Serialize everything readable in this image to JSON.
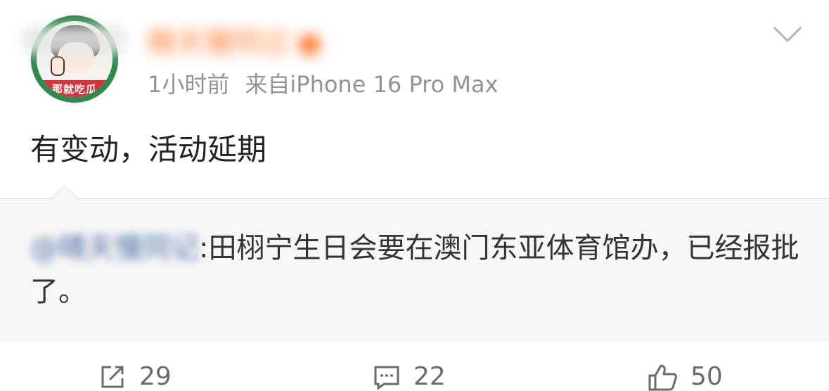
{
  "post": {
    "author_name": "睛天慢同记 ●",
    "avatar_banner": "那就吃瓜",
    "time": "1小时前",
    "source": "来自iPhone 16 Pro Max",
    "text": "有变动，活动延期"
  },
  "repost": {
    "original_author": "@晴天慢同记",
    "text": ":田栩宁生日会要在澳门东亚体育馆办，已经报批了。"
  },
  "actions": {
    "repost_count": "29",
    "comment_count": "22",
    "like_count": "50"
  },
  "colors": {
    "username": "#ff7a2f",
    "meta_text": "#939393",
    "link": "#4e6fa3",
    "repost_bg": "#f7f7f7"
  }
}
